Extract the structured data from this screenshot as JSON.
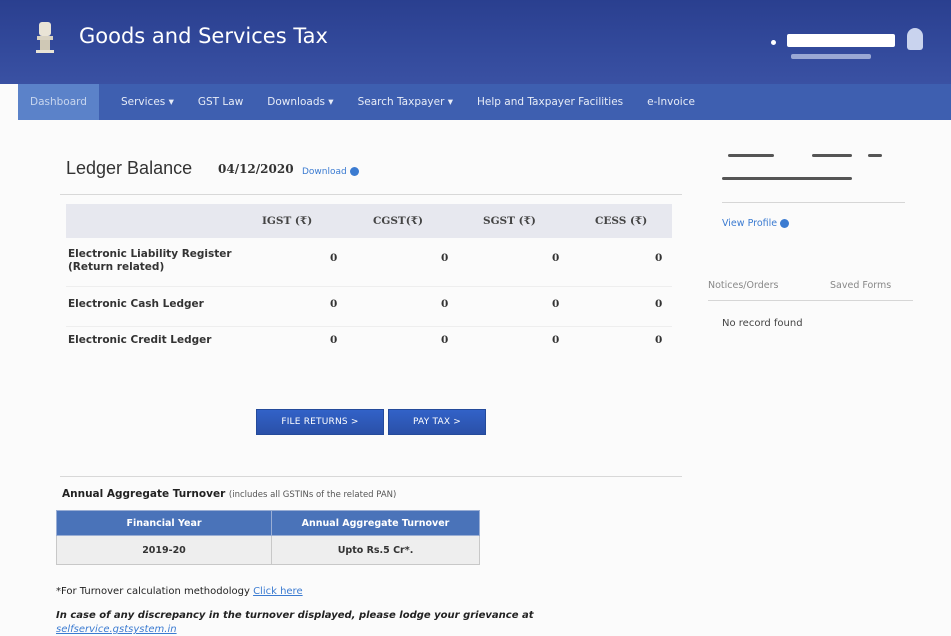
{
  "header": {
    "title": "Goods and Services Tax",
    "emblem": "india-emblem-icon"
  },
  "nav": [
    {
      "label": "Dashboard",
      "active": true
    },
    {
      "label": "Services ▾"
    },
    {
      "label": "GST Law"
    },
    {
      "label": "Downloads ▾"
    },
    {
      "label": "Search Taxpayer ▾"
    },
    {
      "label": "Help and Taxpayer Facilities"
    },
    {
      "label": "e-Invoice"
    }
  ],
  "ledger": {
    "title": "Ledger Balance",
    "date": "04/12/2020",
    "download_label": "Download",
    "columns": [
      "IGST (₹)",
      "CGST(₹)",
      "SGST (₹)",
      "CESS (₹)"
    ],
    "rows": [
      {
        "label": "Electronic Liability Register (Return related)",
        "values": [
          "0",
          "0",
          "0",
          "0"
        ]
      },
      {
        "label": "Electronic Cash Ledger",
        "values": [
          "0",
          "0",
          "0",
          "0"
        ]
      },
      {
        "label": "Electronic Credit Ledger",
        "values": [
          "0",
          "0",
          "0",
          "0"
        ]
      }
    ]
  },
  "actions": {
    "file_returns": "FILE RETURNS >",
    "pay_tax": "PAY TAX >"
  },
  "turnover": {
    "title": "Annual Aggregate Turnover",
    "note": "(includes all GSTINs of the related PAN)",
    "headers": [
      "Financial Year",
      "Annual Aggregate Turnover"
    ],
    "row": [
      "2019-20",
      "Upto Rs.5 Cr*."
    ]
  },
  "footer": {
    "calc_text": "*For Turnover calculation methodology",
    "calc_link": "Click here",
    "grievance": "In case of any discrepancy in the turnover displayed, please lodge your grievance at",
    "selfservice": "selfservice.gstsystem.in"
  },
  "sidebar": {
    "view_profile": "View Profile",
    "tabs": [
      "Notices/Orders",
      "Saved Forms"
    ],
    "no_record": "No record found"
  },
  "colors": {
    "header": "#2a3f8f",
    "nav": "#3e5fb0",
    "link": "#3b7bd1",
    "table_header": "#4a73b9"
  }
}
